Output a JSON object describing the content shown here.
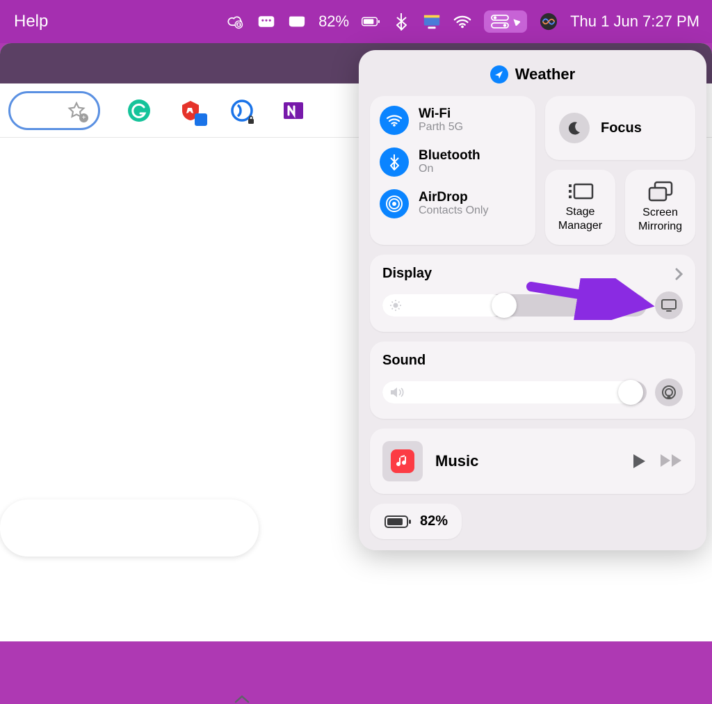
{
  "menubar": {
    "help": "Help",
    "battery_pct": "82%",
    "datetime": "Thu 1 Jun  7:27 PM"
  },
  "control_center": {
    "weather_label": "Weather",
    "wifi": {
      "title": "Wi-Fi",
      "status": "Parth 5G"
    },
    "bluetooth": {
      "title": "Bluetooth",
      "status": "On"
    },
    "airdrop": {
      "title": "AirDrop",
      "status": "Contacts Only"
    },
    "focus_label": "Focus",
    "stage_manager_label": "Stage\nManager",
    "screen_mirroring_label": "Screen\nMirroring",
    "display_label": "Display",
    "display_brightness_pct": 42,
    "sound_label": "Sound",
    "sound_volume_pct": 95,
    "music_label": "Music",
    "battery_pct": "82%"
  }
}
